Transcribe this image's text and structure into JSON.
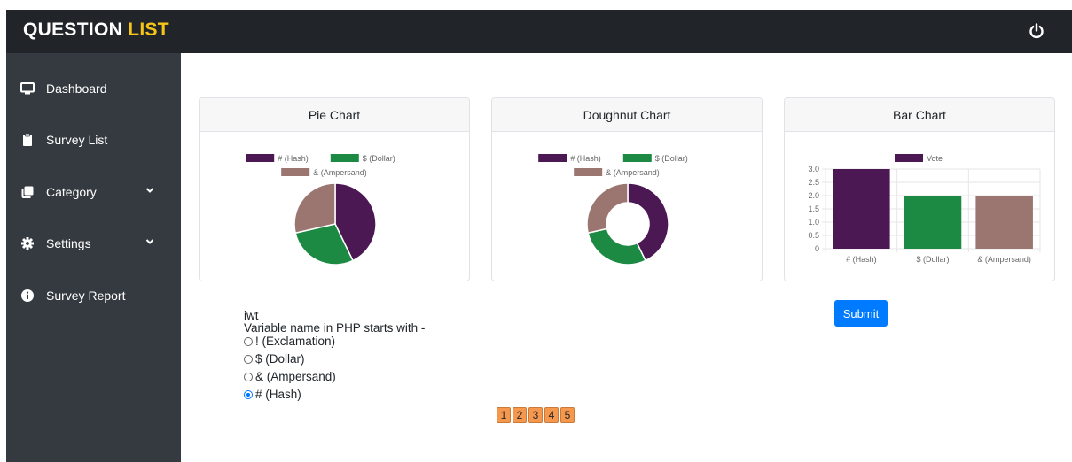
{
  "brand": {
    "part1": "QUESTION",
    "part2": "LIST"
  },
  "header": {
    "logout_icon": "power-icon"
  },
  "sidebar": {
    "items": [
      {
        "label": "Dashboard",
        "icon": "desktop-icon"
      },
      {
        "label": "Survey List",
        "icon": "clipboard-icon"
      },
      {
        "label": "Category",
        "icon": "copy-icon",
        "has_dropdown": true
      },
      {
        "label": "Settings",
        "icon": "gear-icon",
        "has_dropdown": true
      },
      {
        "label": "Survey Report",
        "icon": "info-circle-icon"
      }
    ]
  },
  "colors": {
    "hash": "#4b1854",
    "dollar": "#1d8a44",
    "ampersand": "#9b7671",
    "submit": "#007bff",
    "pager": "#f5974d"
  },
  "chart_data": [
    {
      "type": "pie",
      "title": "Pie Chart",
      "categories": [
        "# (Hash)",
        "$ (Dollar)",
        "& (Ampersand)"
      ],
      "values": [
        3,
        2,
        2
      ],
      "legend": "top"
    },
    {
      "type": "doughnut",
      "title": "Doughnut Chart",
      "categories": [
        "# (Hash)",
        "$ (Dollar)",
        "& (Ampersand)"
      ],
      "values": [
        3,
        2,
        2
      ],
      "legend": "top"
    },
    {
      "type": "bar",
      "title": "Bar Chart",
      "categories": [
        "# (Hash)",
        "$ (Dollar)",
        "& (Ampersand)"
      ],
      "series": [
        {
          "name": "Vote",
          "values": [
            3,
            2,
            2
          ]
        }
      ],
      "ylim": [
        0,
        3
      ],
      "yticks": [
        "3.0",
        "2.5",
        "2.0",
        "1.5",
        "1.0",
        "0.5",
        "0"
      ],
      "grid": true,
      "legend": "top"
    }
  ],
  "submit_label": "Submit",
  "question": {
    "user": "iwt",
    "text": "Variable name in PHP starts with -",
    "options": [
      {
        "label": "! (Exclamation)",
        "checked": false
      },
      {
        "label": "$ (Dollar)",
        "checked": false
      },
      {
        "label": "& (Ampersand)",
        "checked": false
      },
      {
        "label": "# (Hash)",
        "checked": true
      }
    ]
  },
  "pagination": [
    "1",
    "2",
    "3",
    "4",
    "5"
  ]
}
